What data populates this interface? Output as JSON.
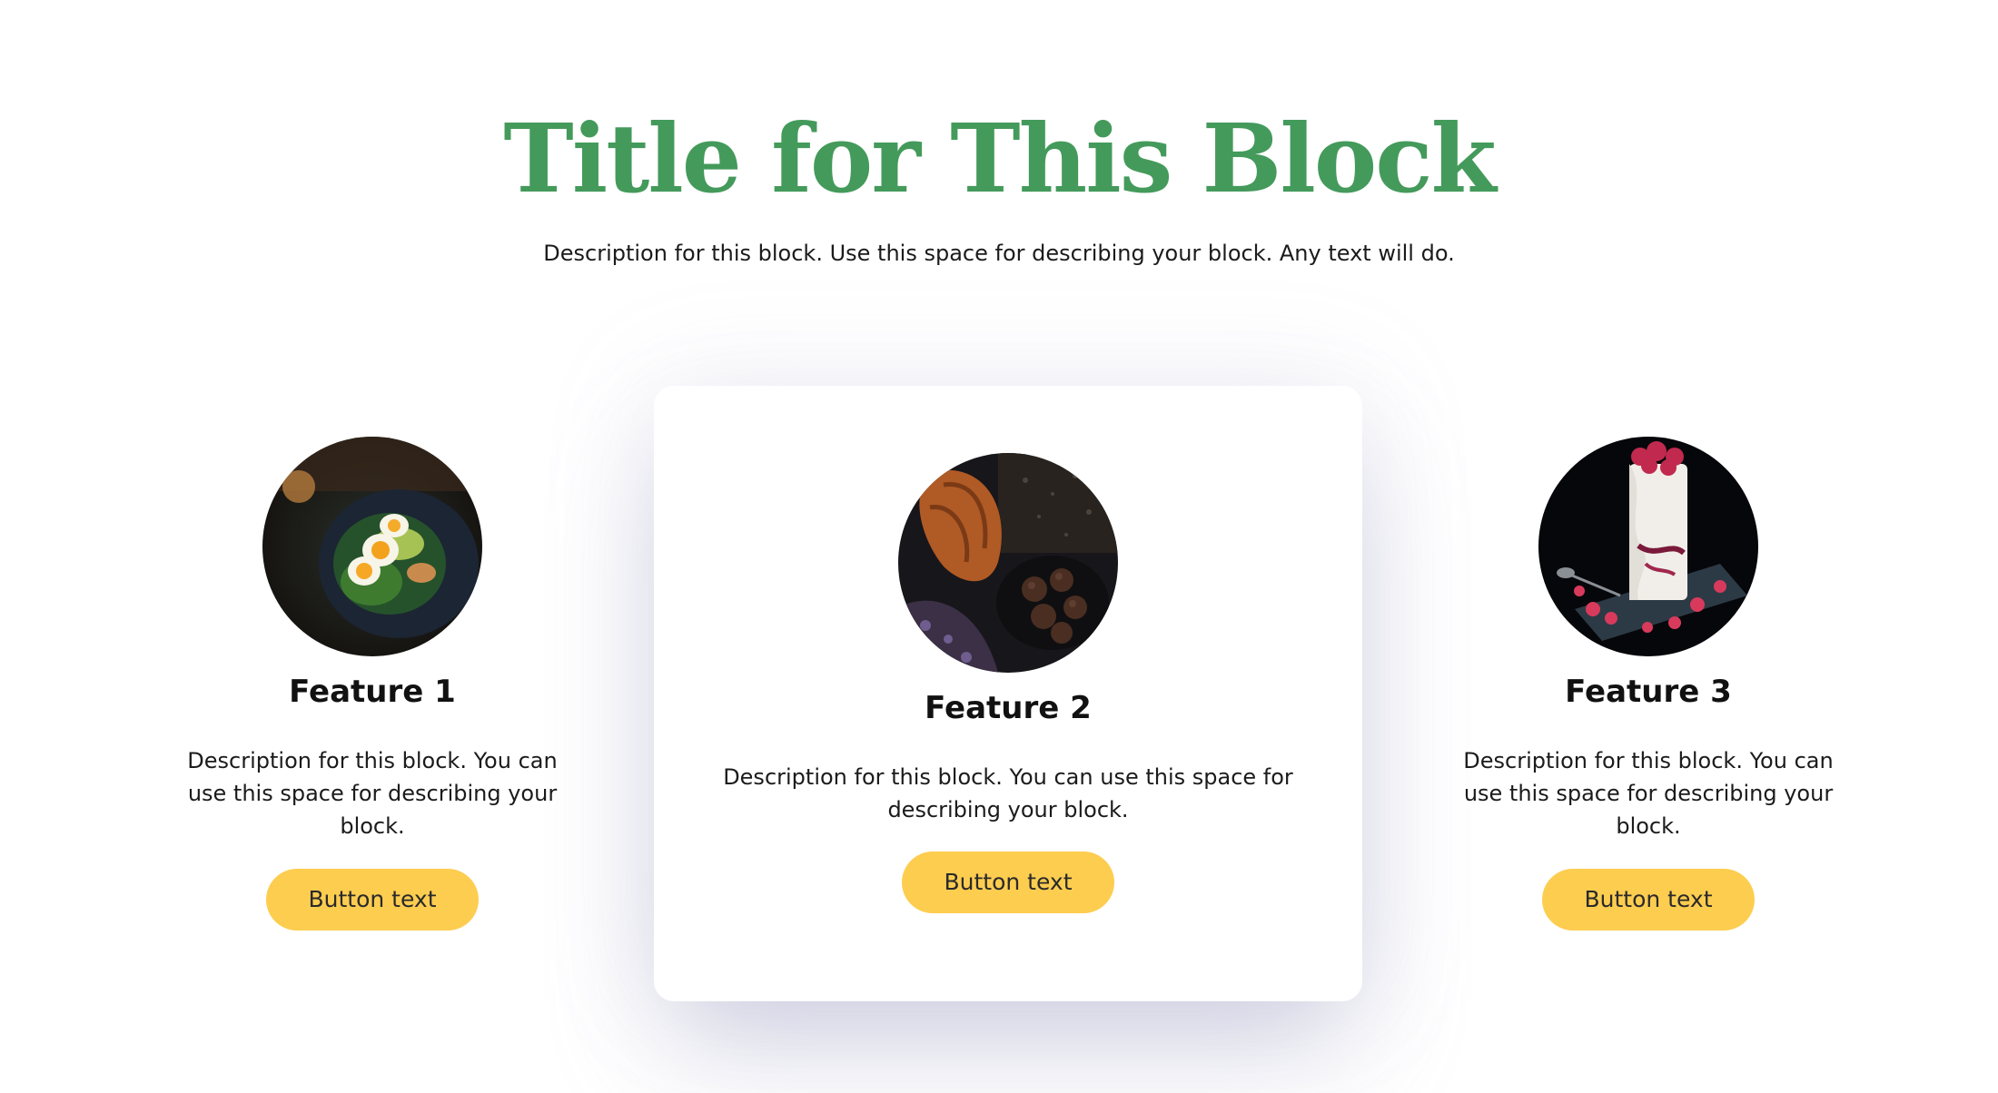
{
  "header": {
    "title": "Title for This Block",
    "description": "Description for this block. Use this space for describing your block. Any text will do."
  },
  "features": [
    {
      "title": "Feature 1",
      "description": "Description for this block. You can use this space for describing your block.",
      "button_label": "Button text",
      "image": "avocado-toast-egg-photo"
    },
    {
      "title": "Feature 2",
      "description": "Description for this block. You can use this space for describing your block.",
      "button_label": "Button text",
      "image": "croissant-chocolate-truffles-photo"
    },
    {
      "title": "Feature 3",
      "description": "Description for this block. You can use this space for describing your block.",
      "button_label": "Button text",
      "image": "raspberry-yogurt-glass-photo"
    }
  ],
  "colors": {
    "title": "#449a5b",
    "button": "#fdcd50",
    "text": "#1b1b1b",
    "background": "#ffffff"
  }
}
